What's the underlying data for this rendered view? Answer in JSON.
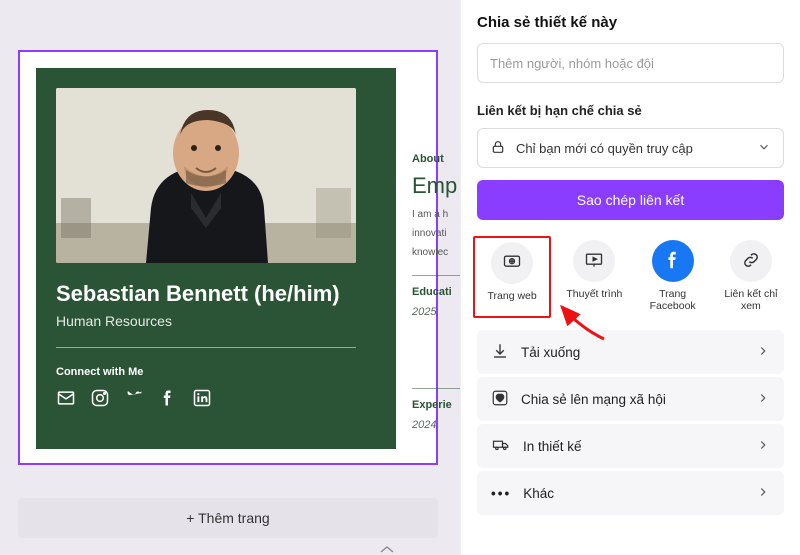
{
  "canvas": {
    "name": "Sebastian Bennett (he/him)",
    "role": "Human Resources",
    "connect_label": "Connect with Me",
    "about_heading": "About",
    "about_big": "Emp",
    "about_p1": "I am a h",
    "about_p2": "innovati",
    "about_p3": "knowlec",
    "edu_heading": "Educati",
    "edu_year": "2025",
    "exp_heading": "Experie",
    "exp_year": "2024"
  },
  "add_page": "+ Thêm trang",
  "share": {
    "title": "Chia sẻ thiết kế này",
    "people_placeholder": "Thêm người, nhóm hoặc đội",
    "link_section": "Liên kết bị hạn chế chia sẻ",
    "access_value": "Chỉ bạn mới có quyền truy cập",
    "copy_button": "Sao chép liên kết",
    "options": {
      "web": "Trang web",
      "present": "Thuyết trình",
      "facebook": "Trang Facebook",
      "viewlink": "Liên kết chỉ xem"
    },
    "menu": {
      "download": "Tải xuống",
      "social": "Chia sẻ lên mạng xã hội",
      "print": "In thiết kế",
      "more": "Khác"
    }
  }
}
